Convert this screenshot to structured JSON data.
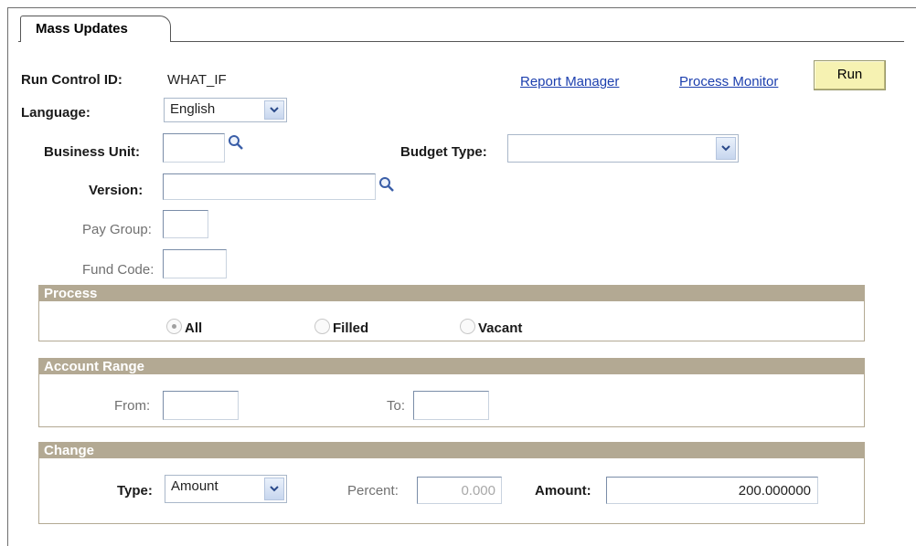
{
  "tab": {
    "label": "Mass Updates"
  },
  "run_control": {
    "label": "Run Control ID:",
    "value": "WHAT_IF"
  },
  "language": {
    "label": "Language:",
    "selected": "English"
  },
  "links": {
    "report_manager": "Report Manager",
    "process_monitor": "Process Monitor"
  },
  "run_button": {
    "label": "Run"
  },
  "business_unit": {
    "label": "Business Unit:",
    "value": ""
  },
  "budget_type": {
    "label": "Budget Type:",
    "selected": ""
  },
  "version": {
    "label": "Version:",
    "value": ""
  },
  "pay_group": {
    "label": "Pay Group:",
    "value": ""
  },
  "fund_code": {
    "label": "Fund Code:",
    "value": ""
  },
  "process": {
    "title": "Process",
    "options": [
      "All",
      "Filled",
      "Vacant"
    ],
    "selected": "All"
  },
  "account_range": {
    "title": "Account Range",
    "from_label": "From:",
    "from_value": "",
    "to_label": "To:",
    "to_value": ""
  },
  "change": {
    "title": "Change",
    "type_label": "Type:",
    "type_selected": "Amount",
    "percent_label": "Percent:",
    "percent_value": "0.000",
    "amount_label": "Amount:",
    "amount_value": "200.000000"
  },
  "icons": {
    "lookup": "magnifier-icon",
    "dropdown": "chevron-down-icon"
  },
  "colors": {
    "section_header": "#b3a993",
    "run_button": "#f6f2b2",
    "link": "#1c3fae"
  }
}
